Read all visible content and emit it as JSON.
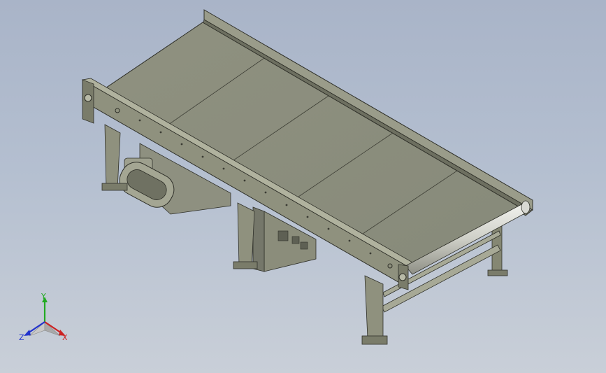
{
  "viewport": {
    "background_top": "#a9b4c8",
    "background_bottom": "#c9cfd8"
  },
  "model": {
    "frame_color": "#8a8c7a",
    "belt_color": "#8b8d7d",
    "roller_color": "#d8d9d3",
    "edge_color": "#2e2f28",
    "belt_segments": 5
  },
  "triad": {
    "x_label": "X",
    "y_label": "Y",
    "z_label": "Z",
    "x_color": "#cc2222",
    "y_color": "#22aa22",
    "z_color": "#2233cc"
  }
}
